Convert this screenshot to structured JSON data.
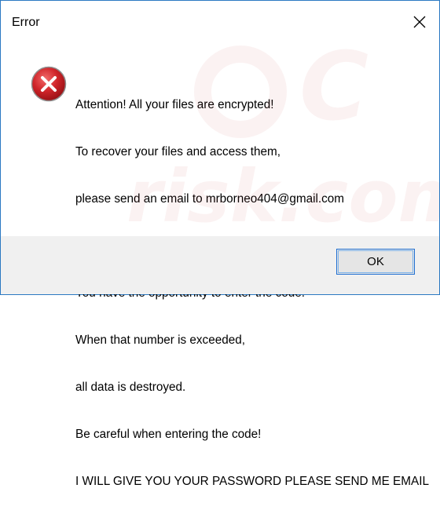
{
  "window": {
    "title": "Error"
  },
  "dialog": {
    "icon": "error-icon",
    "message_lines": [
      "Attention! All your files are encrypted!",
      "To recover your files and access them,",
      "please send an email to mrborneo404@gmail.com",
      "",
      "You have the opportunity to enter the code.",
      "When that number is exceeded,",
      "all data is destroyed.",
      "Be careful when entering the code!",
      "I WILL GIVE YOU YOUR PASSWORD PLEASE SEND ME EMAIL"
    ]
  },
  "buttons": {
    "ok_label": "OK",
    "close_icon": "close-icon"
  },
  "watermark": {
    "text": "PC risk.com"
  },
  "colors": {
    "window_border": "#2b79c2",
    "footer_bg": "#f0f0f0",
    "error_red": "#c8161d",
    "button_border": "#1f6fd2"
  }
}
